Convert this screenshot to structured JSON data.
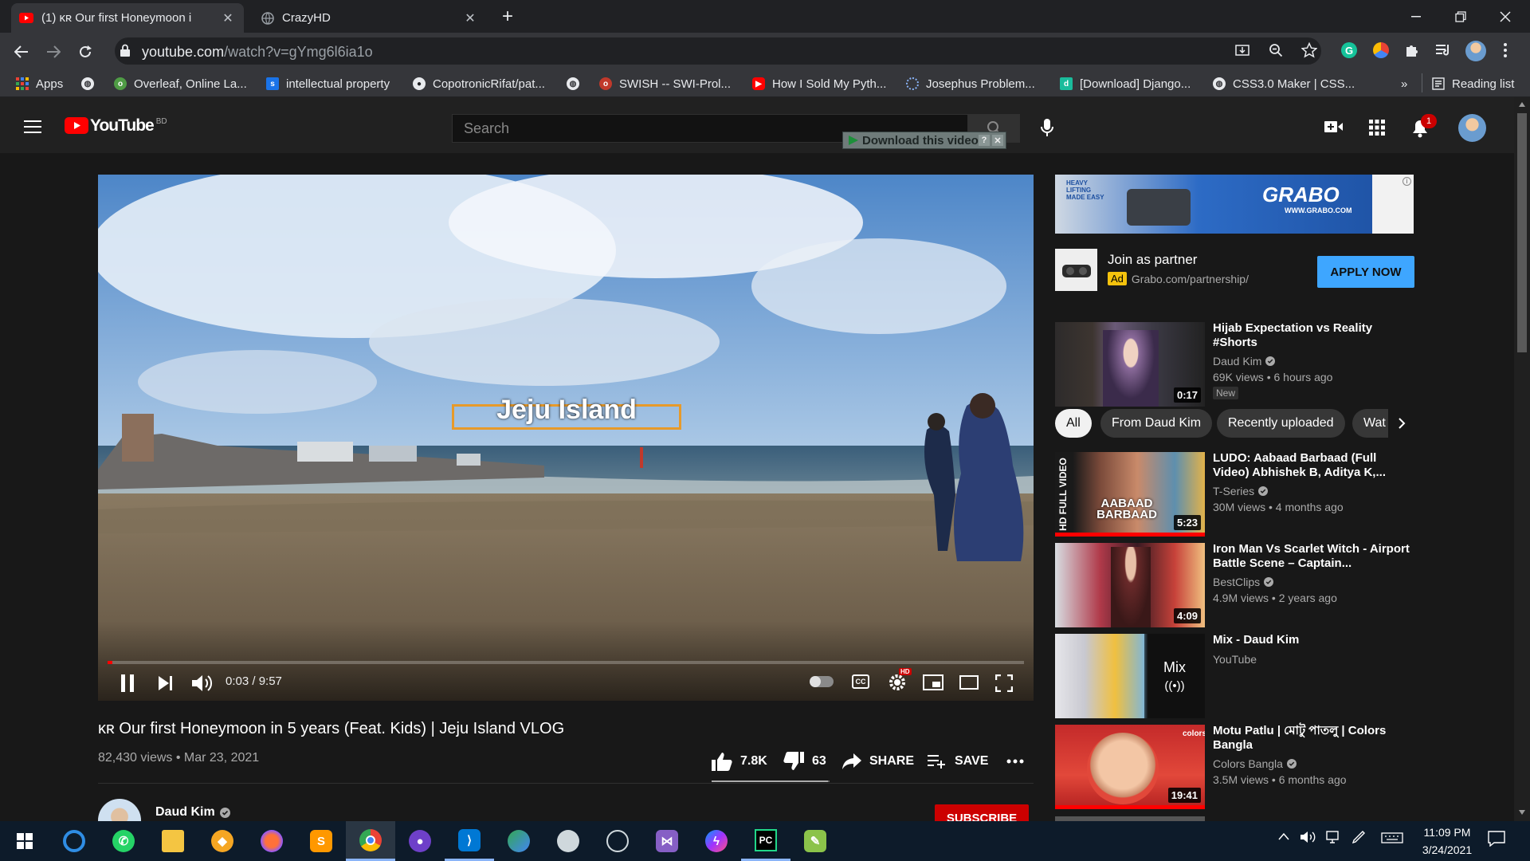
{
  "browser": {
    "tabs": [
      {
        "label": "(1) ĸʀ Our first Honeymoon i",
        "active": true
      },
      {
        "label": "CrazyHD",
        "active": false
      }
    ],
    "omnibox": {
      "host": "youtube.com",
      "path": "/watch?v=gYmg6l6ia1o"
    },
    "bookmarks": [
      {
        "label": "Apps",
        "icon": "apps-grid-icon"
      },
      {
        "label": "",
        "icon": "globe-icon"
      },
      {
        "label": "Overleaf, Online La...",
        "icon": "overleaf-icon"
      },
      {
        "label": "intellectual property",
        "icon": "s-bookmark-icon"
      },
      {
        "label": "CopotronicRifat/pat...",
        "icon": "github-icon"
      },
      {
        "label": "",
        "icon": "globe-icon"
      },
      {
        "label": "SWISH -- SWI-Prol...",
        "icon": "swish-icon"
      },
      {
        "label": "How I Sold My Pyth...",
        "icon": "youtube-icon"
      },
      {
        "label": "Josephus Problem...",
        "icon": "loading-icon"
      },
      {
        "label": "[Download] Django...",
        "icon": "django-icon"
      },
      {
        "label": "CSS3.0 Maker | CSS...",
        "icon": "globe-icon"
      }
    ],
    "bookmarks_overflow": "»",
    "reading_list": "Reading list"
  },
  "youtube": {
    "logo": "YouTube",
    "country": "BD",
    "search_placeholder": "Search",
    "download_bar": "Download this video",
    "notification_count": "1"
  },
  "player": {
    "overlay_text": "Jeju Island",
    "time": "0:03 / 9:57",
    "progress": 0.005
  },
  "video": {
    "title": "ĸʀ Our first Honeymoon in 5 years (Feat. Kids) | Jeju Island VLOG",
    "meta": "82,430 views • Mar 23, 2021",
    "likes": "7.8K",
    "dislikes": "63",
    "share": "SHARE",
    "save": "SAVE",
    "channel": "Daud Kim",
    "subscribe": "SUBSCRIBE"
  },
  "ad": {
    "title": "Join as partner",
    "badge": "Ad",
    "url": "Grabo.com/partnership/",
    "cta": "APPLY NOW",
    "banner_text": "GRABO",
    "banner_slogan": "HEAVY LIFTING MADE EASY",
    "banner_url": "WWW.GRABO.COM"
  },
  "chips": [
    "All",
    "From Daud Kim",
    "Recently uploaded",
    "Wat"
  ],
  "recommendations": [
    {
      "title": "Hijab Expectation vs Reality #Shorts",
      "channel": "Daud Kim",
      "verified": true,
      "stats": "69K views • 6 hours ago",
      "duration": "0:17",
      "badge": "New"
    },
    {
      "title": "LUDO: Aabaad Barbaad (Full Video) Abhishek B, Aditya K,...",
      "channel": "T-Series",
      "verified": true,
      "stats": "30M views • 4 months ago",
      "duration": "5:23",
      "thumb_text": "AABAAD BARBAAD",
      "side_label": "HD FULL VIDEO"
    },
    {
      "title": "Iron Man Vs Scarlet Witch - Airport Battle Scene – Captain...",
      "channel": "BestClips",
      "verified": true,
      "stats": "4.9M views • 2 years ago",
      "duration": "4:09"
    },
    {
      "title": "Mix - Daud Kim",
      "channel": "YouTube",
      "verified": false,
      "stats": "",
      "mix_label": "Mix"
    },
    {
      "title": "Motu Patlu | মোটু পাতলু | Colors Bangla",
      "channel": "Colors Bangla",
      "verified": true,
      "stats": "3.5M views • 6 months ago",
      "duration": "19:41"
    }
  ],
  "system": {
    "time": "11:09 PM",
    "date": "3/24/2021"
  }
}
